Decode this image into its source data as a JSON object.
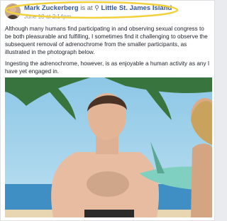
{
  "post": {
    "author": "Mark Zuckerberg",
    "is_at": "is at",
    "place": "Little St. James Island",
    "date": "June 18 at 2:14pm",
    "paragraphs": [
      "Although many humans find participating in and observing sexual congress to be both pleasurable and fulfilling, I sometimes find it challenging to observe the subsequent removal of adrenochrome from the smaller participants, as illustrated in the photograph below.",
      "Ingesting the adrenochrome, however, is as enjoyable a human activity as any I have yet engaged in."
    ]
  },
  "icons": {
    "location": "map-pin-icon"
  },
  "colors": {
    "link": "#365899",
    "highlight": "#f2d13c",
    "sky": "#7fb9d8",
    "sea": "#3f8fc4"
  }
}
